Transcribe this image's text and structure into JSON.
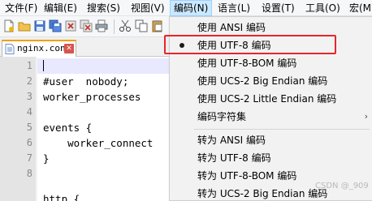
{
  "menubar": {
    "items": [
      {
        "label": "文件(F)"
      },
      {
        "label": "编辑(E)"
      },
      {
        "label": "搜索(S)"
      },
      {
        "label": "视图(V)"
      },
      {
        "label": "编码(N)"
      },
      {
        "label": "语言(L)"
      },
      {
        "label": "设置(T)"
      },
      {
        "label": "工具(O)"
      },
      {
        "label": "宏(M"
      }
    ]
  },
  "tab": {
    "label": "nginx.conf",
    "close": "✕"
  },
  "editor": {
    "line_numbers": [
      "1",
      "2",
      "3",
      "4",
      "5",
      "6",
      "7",
      "8"
    ],
    "lines": [
      "",
      "#user  nobody;",
      "worker_processes",
      "",
      "events {",
      "    worker_connect",
      "}",
      "",
      "http {"
    ]
  },
  "encoding_menu": {
    "items": [
      {
        "label": "使用 ANSI 编码"
      },
      {
        "label": "使用 UTF-8 编码"
      },
      {
        "label": "使用 UTF-8-BOM 编码"
      },
      {
        "label": "使用 UCS-2 Big Endian 编码"
      },
      {
        "label": "使用 UCS-2 Little Endian 编码"
      },
      {
        "label": "编码字符集"
      },
      {
        "label": "转为 ANSI 编码"
      },
      {
        "label": "转为 UTF-8 编码"
      },
      {
        "label": "转为 UTF-8-BOM 编码"
      },
      {
        "label": "转为 UCS-2 Big Endian 编码"
      }
    ],
    "submenu_arrow": "›"
  },
  "watermark": "CSDN @_909",
  "colors": {
    "highlight": "#e8262b",
    "menu_active": "#cce8ff",
    "tab_accent": "#f0a000",
    "current_line": "#e8e8ff"
  }
}
